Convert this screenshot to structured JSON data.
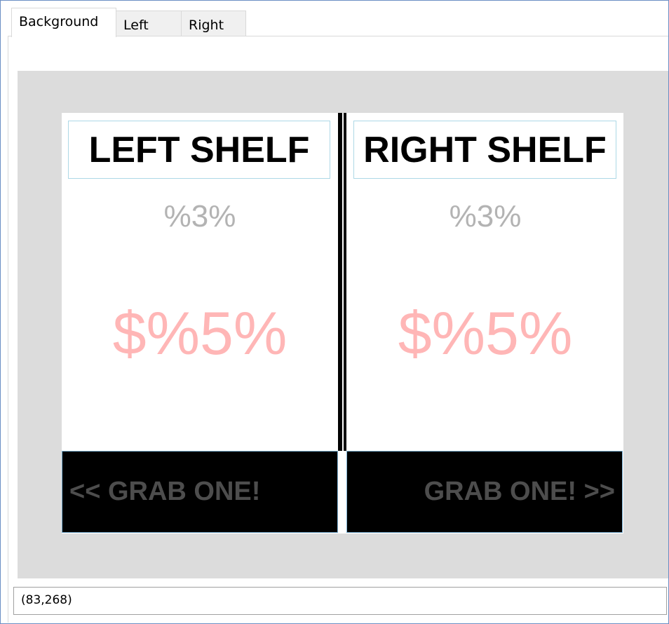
{
  "tabs": [
    {
      "label": "Background",
      "active": true
    },
    {
      "label": "Left",
      "active": false
    },
    {
      "label": "Right",
      "active": false
    }
  ],
  "left_shelf": {
    "title": "LEFT SHELF",
    "small_value": "%3%",
    "price": "$%5%",
    "grab_label": "<< GRAB ONE!"
  },
  "right_shelf": {
    "title": "RIGHT SHELF",
    "small_value": "%3%",
    "price": "$%5%",
    "grab_label": "GRAB ONE! >>"
  },
  "status": {
    "coordinates": "(83,268)"
  },
  "colors": {
    "canvas_background": "#dcdcdc",
    "title_border": "#add8e6",
    "small_value_text": "#b3b3b3",
    "price_text": "#ffb6b6",
    "grab_background": "#000000",
    "grab_text": "#4d4d4d"
  }
}
